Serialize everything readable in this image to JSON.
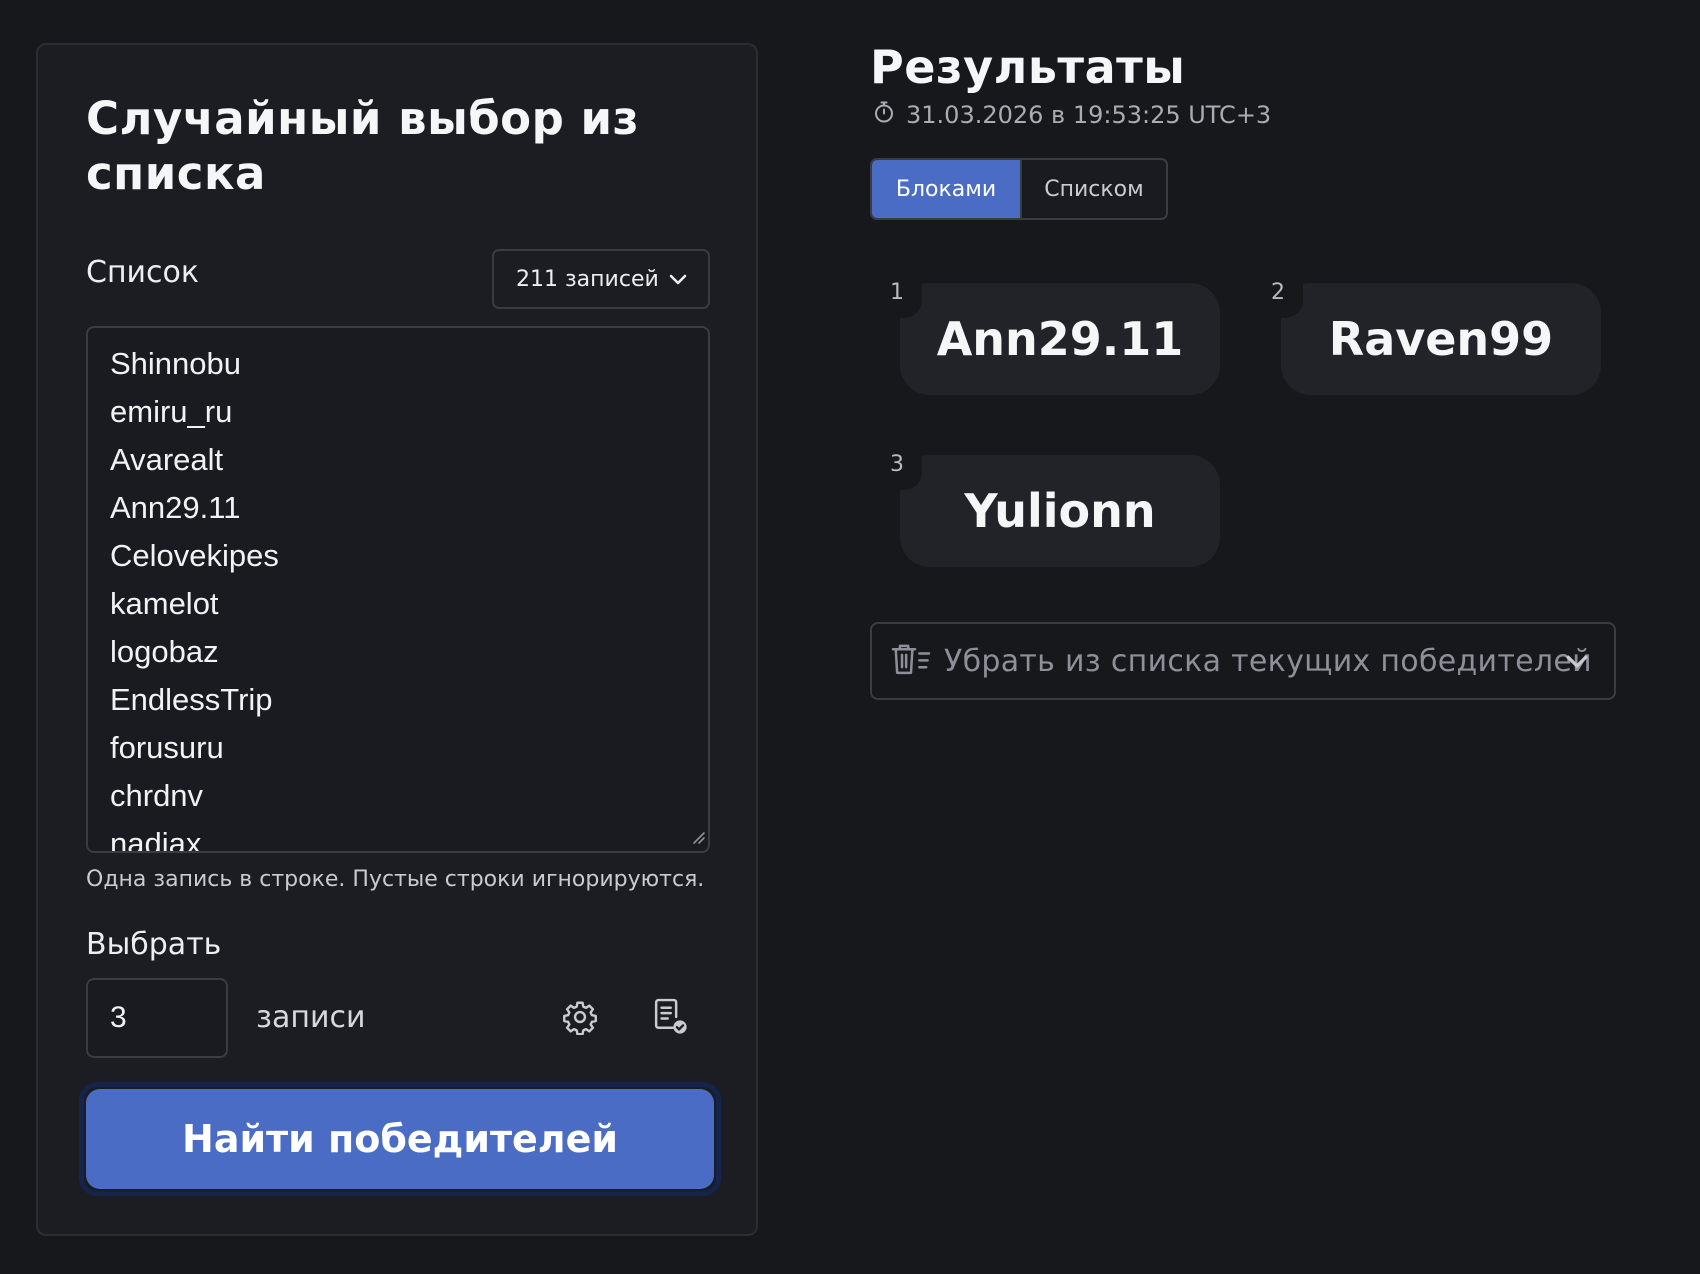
{
  "left_panel": {
    "title": "Случайный выбор из списка",
    "list_label": "Список",
    "count_select": "211 записей",
    "entries": [
      "Shinnobu",
      "emiru_ru",
      "Avarealt",
      "Ann29.11",
      "Celovekipes",
      "kamelot",
      "logobaz",
      "EndlessTrip",
      "forusuru",
      "chrdnv",
      "nadiax"
    ],
    "hint": "Одна запись в строке. Пустые строки игнорируются.",
    "pick_label": "Выбрать",
    "pick_value": "3",
    "pick_unit": "записи",
    "find_button": "Найти победителей"
  },
  "results": {
    "title": "Результаты",
    "timestamp": "31.03.2026 в 19:53:25 UTC+3",
    "tabs": [
      {
        "label": "Блоками",
        "active": true
      },
      {
        "label": "Списком",
        "active": false
      }
    ],
    "winners": [
      {
        "rank": "1",
        "name": "Ann29.11"
      },
      {
        "rank": "2",
        "name": "Raven99"
      },
      {
        "rank": "3",
        "name": "Yulionn"
      }
    ],
    "remove_select": "Убрать из списка текущих победителей"
  },
  "colors": {
    "background": "#17181c",
    "panel": "#1c1d22",
    "accent": "#4a6cc4",
    "card": "#222329"
  },
  "icons": [
    "chevron-down-icon",
    "resize-grip-icon",
    "gear-icon",
    "report-check-icon",
    "stopwatch-icon",
    "trash-list-icon"
  ]
}
